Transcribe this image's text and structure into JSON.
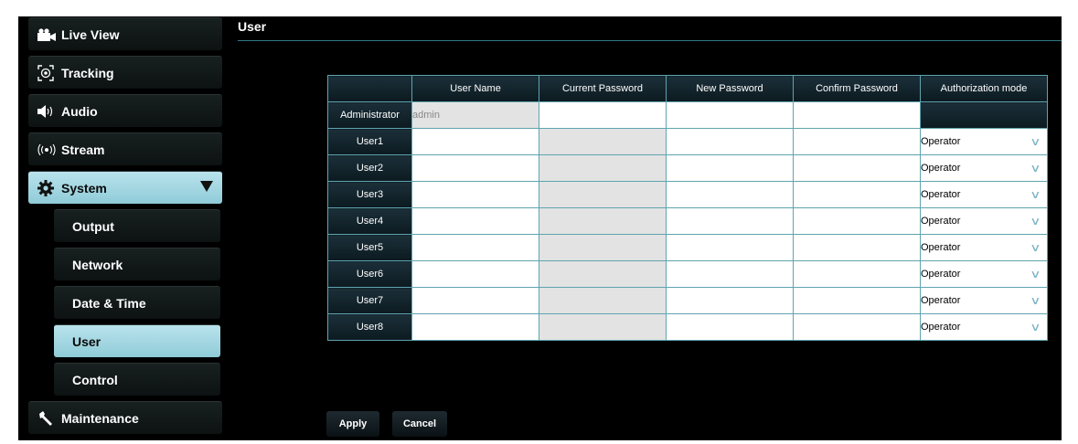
{
  "sidebar": {
    "live_view": "Live View",
    "tracking": "Tracking",
    "audio": "Audio",
    "stream": "Stream",
    "system": "System",
    "output": "Output",
    "network": "Network",
    "date_time": "Date & Time",
    "user": "User",
    "control": "Control",
    "maintenance": "Maintenance"
  },
  "page": {
    "title": "User"
  },
  "table": {
    "headers": [
      "",
      "User Name",
      "Current Password",
      "New Password",
      "Confirm Password",
      "Authorization mode"
    ],
    "admin": {
      "label": "Administrator",
      "username": "admin"
    },
    "users": [
      {
        "label": "User1",
        "mode": "Operator"
      },
      {
        "label": "User2",
        "mode": "Operator"
      },
      {
        "label": "User3",
        "mode": "Operator"
      },
      {
        "label": "User4",
        "mode": "Operator"
      },
      {
        "label": "User5",
        "mode": "Operator"
      },
      {
        "label": "User6",
        "mode": "Operator"
      },
      {
        "label": "User7",
        "mode": "Operator"
      },
      {
        "label": "User8",
        "mode": "Operator"
      }
    ]
  },
  "buttons": {
    "apply": "Apply",
    "cancel": "Cancel"
  },
  "colors": {
    "accent": "#9dd6e2",
    "border": "#5fa4b0",
    "background": "#000000"
  }
}
